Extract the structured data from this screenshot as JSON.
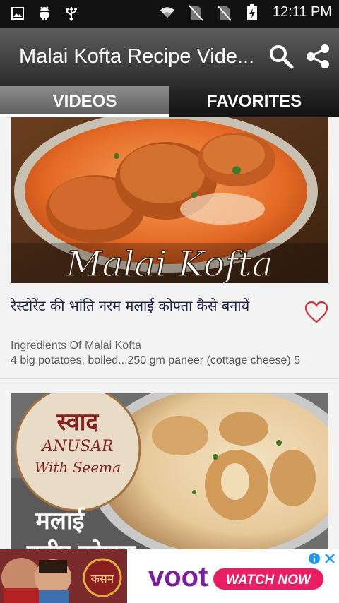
{
  "statusbar": {
    "time": "12:11 PM",
    "left_icons": [
      "image-icon",
      "android-icon",
      "usb-icon"
    ],
    "right_icons": [
      "wifi-icon",
      "no-sim-icon",
      "no-sim-icon",
      "battery-charging-icon"
    ]
  },
  "appbar": {
    "title": "Malai Kofta Recipe Vide...",
    "search_icon": "search-icon",
    "share_icon": "share-icon"
  },
  "tabs": [
    {
      "label": "VIDEOS",
      "selected": true
    },
    {
      "label": "FAVORITES",
      "selected": false
    }
  ],
  "videos": [
    {
      "thumb_text": "Malai Kofta",
      "title": "रेस्टोरेंट की भांति नरम मलाई कोफ्ता कैसे बनायें",
      "subtitle": "Ingredients Of Malai Kofta",
      "description": "4 big potatoes, boiled...250 gm paneer (cottage cheese) 5"
    },
    {
      "badge_line1": "स्वाद",
      "badge_line2": "ANUSAR",
      "badge_line3": "With Seema",
      "thumb_text": "मलाई",
      "thumb_text2": "पनीर कोफ्ता"
    }
  ],
  "ad": {
    "brand": "voot",
    "cta": "WATCH NOW",
    "show_label": "कसम"
  },
  "colors": {
    "heart": "#d32f2f",
    "title_text": "#1a1f44",
    "voot_purple": "#7a1fa2",
    "cta_pink": "#e91e63"
  }
}
